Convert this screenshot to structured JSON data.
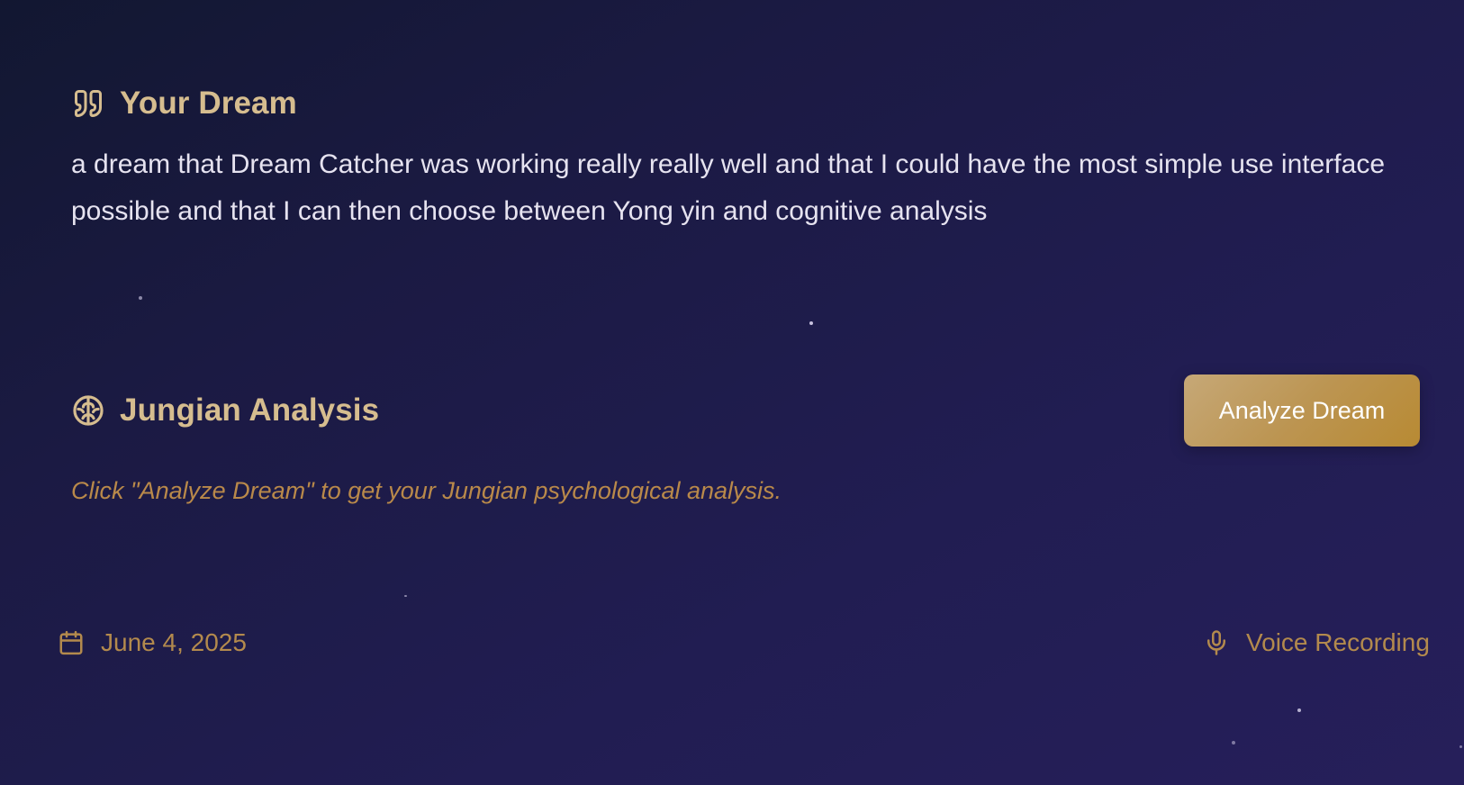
{
  "dream": {
    "heading": "Your Dream",
    "heading_icon": "quote-icon",
    "text": "a dream that Dream Catcher was working really really well and that I could have the most simple use interface possible and that I can then choose between Yong yin and cognitive analysis"
  },
  "analysis": {
    "heading": "Jungian Analysis",
    "heading_icon": "brain-icon",
    "button_label": "Analyze Dream",
    "hint": "Click \"Analyze Dream\" to get your Jungian psychological analysis."
  },
  "footer": {
    "date": "June 4, 2025",
    "date_icon": "calendar-icon",
    "source": "Voice Recording",
    "source_icon": "microphone-icon"
  },
  "colors": {
    "accent_gold": "#d6bd8f",
    "muted_gold": "#b38a4d",
    "button_gradient_start": "#c6a877",
    "button_gradient_end": "#b88a33",
    "background_dark": "#121731",
    "background_purple": "#261f5a",
    "body_text": "#e6e3f0"
  }
}
